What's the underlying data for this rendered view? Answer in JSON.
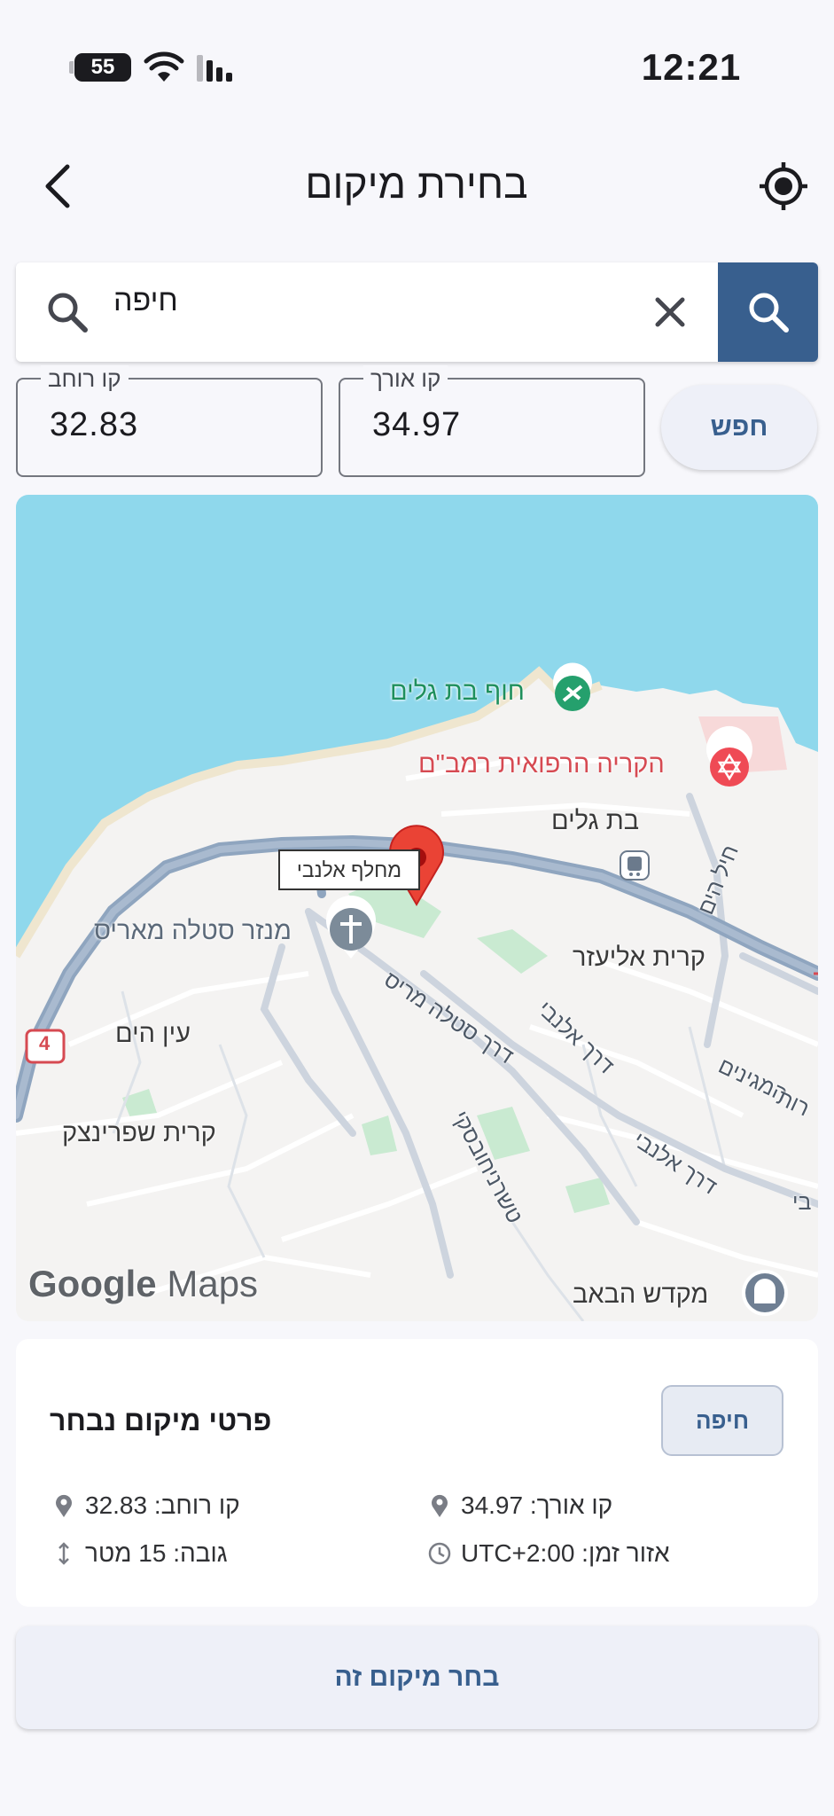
{
  "status_bar": {
    "time": "12:21",
    "battery": "55"
  },
  "header": {
    "title": "בחירת מיקום"
  },
  "search": {
    "value": "חיפה"
  },
  "coords": {
    "lat_label": "קו רוחב",
    "lat_value": "32.83",
    "lon_label": "קו אורך",
    "lon_value": "34.97",
    "find_label": "חפש"
  },
  "map": {
    "labels": {
      "beach": "חוף בת גלים",
      "hospital": "הקריה הרפואית רמב\"ם",
      "bat_galim": "בת גלים",
      "interchange": "מחלף אלנבי",
      "monastery": "מנזר סטלה מאריס",
      "kiryat_eliezer": "קרית אליעזר",
      "ein_hayam": "עין הים",
      "kiryat_sprinzak": "קרית שפרינצק",
      "road_stella": "דרך סטלה מריס",
      "road_allenby_1": "דרך אלנבי",
      "road_allenby_2": "דרך אלנבי",
      "road_chernichovsky": "טשרניחובסקי",
      "road_chel_hayam": "חיל הים",
      "road_meginim": "המגינים",
      "road_partial_1": "רות",
      "road_partial_2": "בי",
      "mikdash": "מקדש הבאב",
      "route_4": "4"
    },
    "logo_google": "Google",
    "logo_maps": "Maps"
  },
  "details": {
    "title": "פרטי מיקום נבחר",
    "city_chip": "חיפה",
    "lat": "קו רוחב: 32.83",
    "lon": "קו אורך: 34.97",
    "elevation": "גובה: 15 מטר",
    "timezone": "אזור זמן: UTC+2:00"
  },
  "select_button": "בחר מיקום זה",
  "colors": {
    "accent": "#385f8e",
    "marker": "#ea4335",
    "water": "#8fd8ec"
  }
}
